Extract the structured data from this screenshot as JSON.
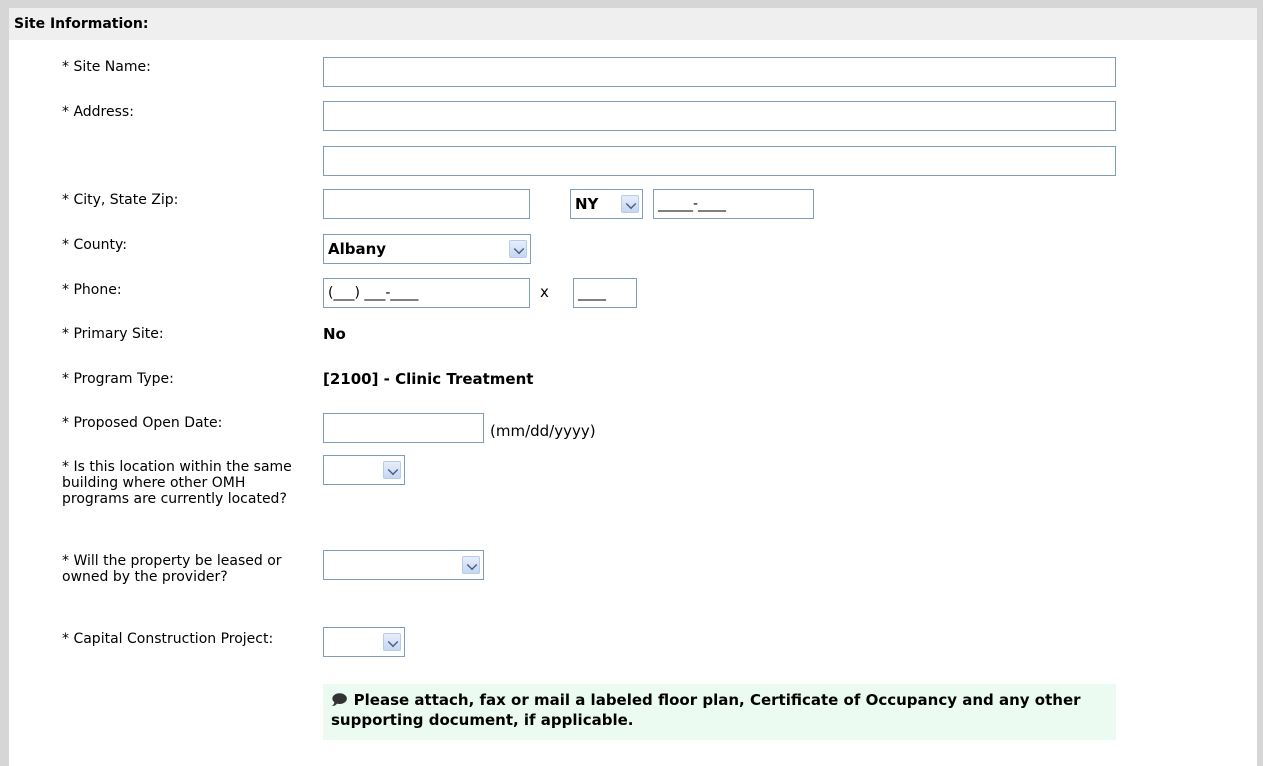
{
  "section": {
    "title": "Site Information:"
  },
  "fields": {
    "site_name_label": "* Site Name:",
    "address_label": "* Address:",
    "city_label": "* City, State Zip:",
    "state_value": "NY",
    "zip_value": "_____-____",
    "county_label": "* County:",
    "county_value": "Albany",
    "phone_label": "* Phone:",
    "phone_value": "(___) ___-____",
    "phone_ext_sep": "x",
    "phone_ext_value": "____",
    "primary_site_label": "* Primary Site:",
    "primary_site_value": "No",
    "program_type_label": "* Program Type:",
    "program_type_value": "[2100] - Clinic Treatment",
    "open_date_label": "* Proposed Open Date:",
    "open_date_hint": "(mm/dd/yyyy)",
    "same_building_label": "* Is this location within the same building where other OMH programs are currently located?",
    "leased_owned_label": "* Will the property be leased or owned by the provider?",
    "capital_label": "* Capital Construction Project:"
  },
  "note": {
    "icon": "speech-bubble-icon",
    "text": "Please attach, fax or mail a labeled floor plan, Certificate of Occupancy and any other supporting document, if applicable."
  }
}
